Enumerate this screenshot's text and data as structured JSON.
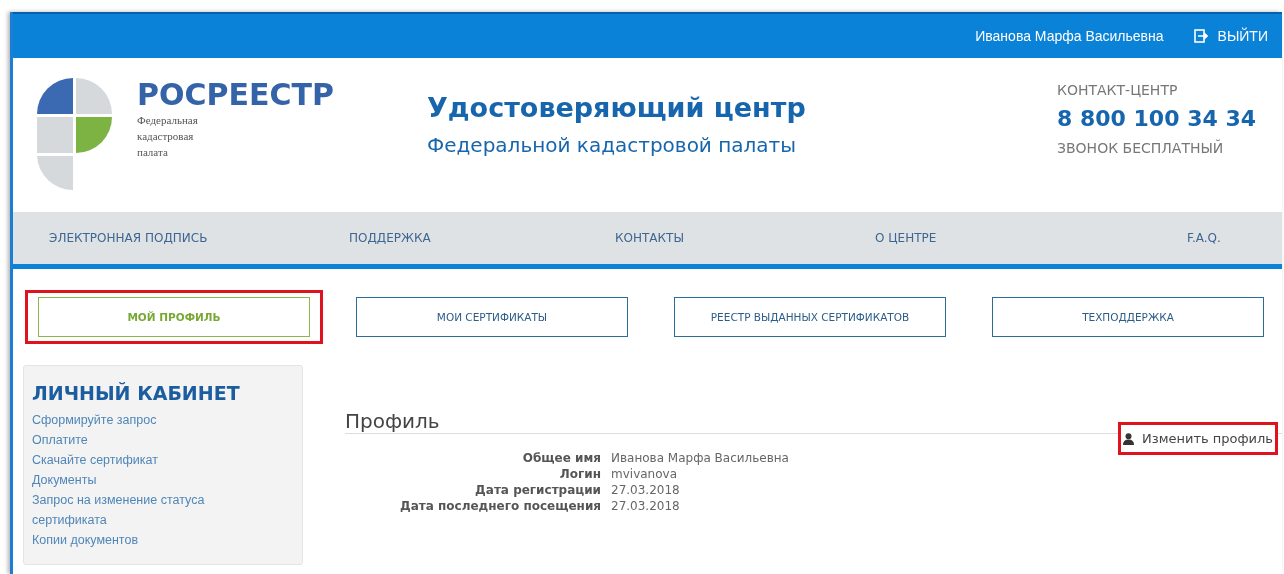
{
  "top_bar": {
    "user_name": "Иванова Марфа Васильевна",
    "logout": "ВЫЙТИ"
  },
  "logo": {
    "name": "РОСРЕЕСТР",
    "subtitle": [
      "Федеральная",
      "кадастровая",
      "палата"
    ]
  },
  "header": {
    "title": "Удостоверяющий центр",
    "subtitle": "Федеральной кадастровой палаты"
  },
  "contact": {
    "label": "КОНТАКТ-ЦЕНТР",
    "phone": "8 800 100 34 34",
    "note": "ЗВОНОК БЕСПЛАТНЫЙ"
  },
  "nav": [
    "ЭЛЕКТРОННАЯ ПОДПИСЬ",
    "ПОДДЕРЖКА",
    "КОНТАКТЫ",
    "О ЦЕНТРЕ",
    "F.A.Q."
  ],
  "tabs": [
    {
      "label": "МОЙ ПРОФИЛЬ",
      "selected": true,
      "highlighted": true
    },
    {
      "label": "МОИ СЕРТИФИКАТЫ",
      "selected": false,
      "highlighted": false
    },
    {
      "label": "РЕЕСТР ВЫДАННЫХ СЕРТИФИКАТОВ",
      "selected": false,
      "highlighted": false
    },
    {
      "label": "ТЕХПОДДЕРЖКА",
      "selected": false,
      "highlighted": false
    }
  ],
  "sidebar": {
    "title": "ЛИЧНЫЙ КАБИНЕТ",
    "items": [
      "Сформируйте запрос",
      "Оплатите",
      "Скачайте сертификат",
      "Документы",
      "Запрос на изменение статуса сертификата",
      "Копии документов"
    ]
  },
  "profile": {
    "title": "Профиль",
    "edit_button": {
      "label": "Изменить профиль",
      "highlighted": true
    },
    "fields": [
      {
        "label": "Общее имя",
        "value": "Иванова Марфа Васильевна"
      },
      {
        "label": "Логин",
        "value": "mvivanova"
      },
      {
        "label": "Дата регистрации",
        "value": "27.03.2018"
      },
      {
        "label": "Дата последнего посещения",
        "value": "27.03.2018"
      }
    ]
  }
}
